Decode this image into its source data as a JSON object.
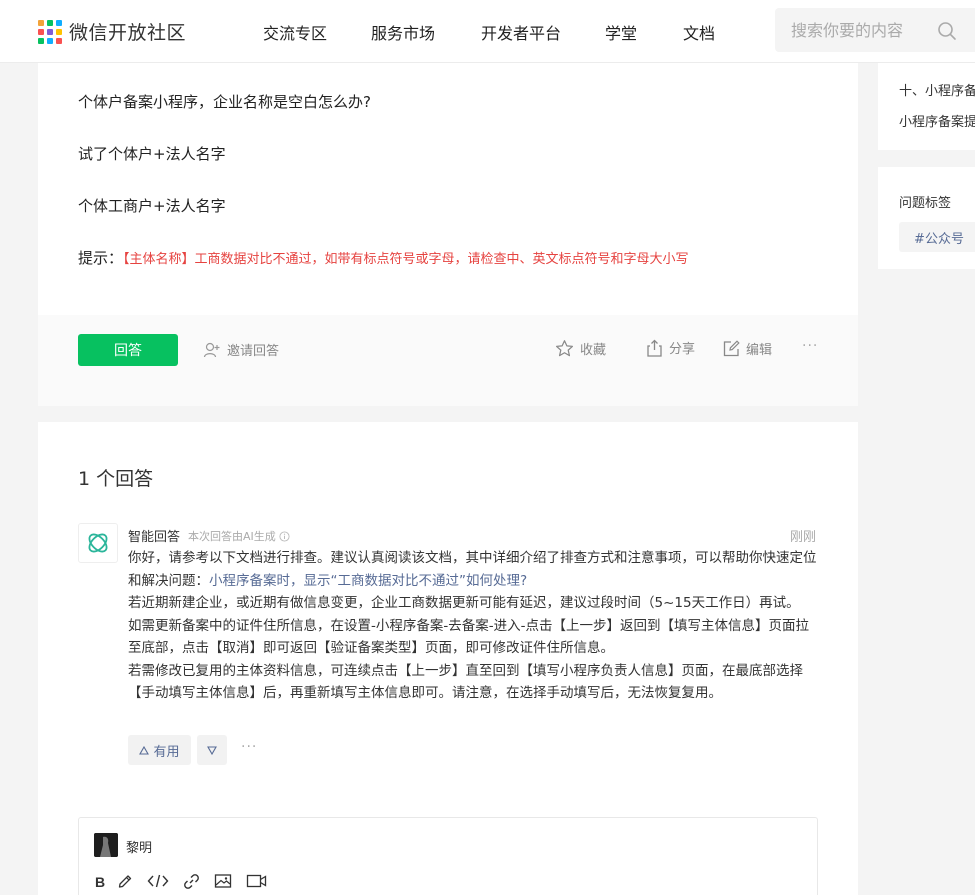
{
  "header": {
    "logo_text": "微信开放社区",
    "nav": [
      "交流专区",
      "服务市场",
      "开发者平台",
      "学堂",
      "文档"
    ],
    "search_placeholder": "搜索你要的内容",
    "logo_colors": [
      "#f2a33a",
      "#07c160",
      "#10aeff",
      "#fa5151",
      "#7f5cd7",
      "#ffc300",
      "#07c160",
      "#10aeff",
      "#fa5151"
    ]
  },
  "question": {
    "lines": [
      "个体户备案小程序，企业名称是空白怎么办?",
      "试了个体户+法人名字",
      "个体工商户+法人名字"
    ],
    "hint_label": "提示：",
    "hint_text": "【主体名称】工商数据对比不通过，如带有标点符号或字母，请检查中、英文标点符号和字母大小写",
    "answer_button": "回答",
    "invite": "邀请回答",
    "favorite": "收藏",
    "share": "分享",
    "edit": "编辑",
    "more": "···"
  },
  "answers": {
    "count_label": "1 个回答",
    "ai": {
      "name": "智能回答",
      "subtitle": "本次回答由AI生成",
      "time": "刚刚",
      "intro": "你好，请参考以下文档进行排查。建议认真阅读该文档，其中详细介绍了排查方式和注意事项，可以帮助你快速定位和解决问题：",
      "link": "小程序备案时，显示“工商数据对比不通过”如何处理?",
      "p1": "若近期新建企业，或近期有做信息变更，企业工商数据更新可能有延迟，建议过段时间（5~15天工作日）再试。",
      "p2": "如需更新备案中的证件住所信息，在设置-小程序备案-去备案-进入-点击【上一步】返回到【填写主体信息】页面拉至底部，点击【取消】即可返回【验证备案类型】页面，即可修改证件住所信息。",
      "p3": "若需修改已复用的主体资料信息，可连续点击【上一步】直至回到【填写小程序负责人信息】页面，在最底部选择【手动填写主体信息】后，再重新填写主体信息即可。请注意，在选择手动填写后，无法恢复复用。",
      "useful": "有用",
      "more": "···"
    },
    "editor": {
      "user": "黎明",
      "bold": "B"
    }
  },
  "sidebar": {
    "related": [
      "十、小程序备",
      "小程序备案提"
    ],
    "tags_title": "问题标签",
    "tag": "#公众号"
  }
}
